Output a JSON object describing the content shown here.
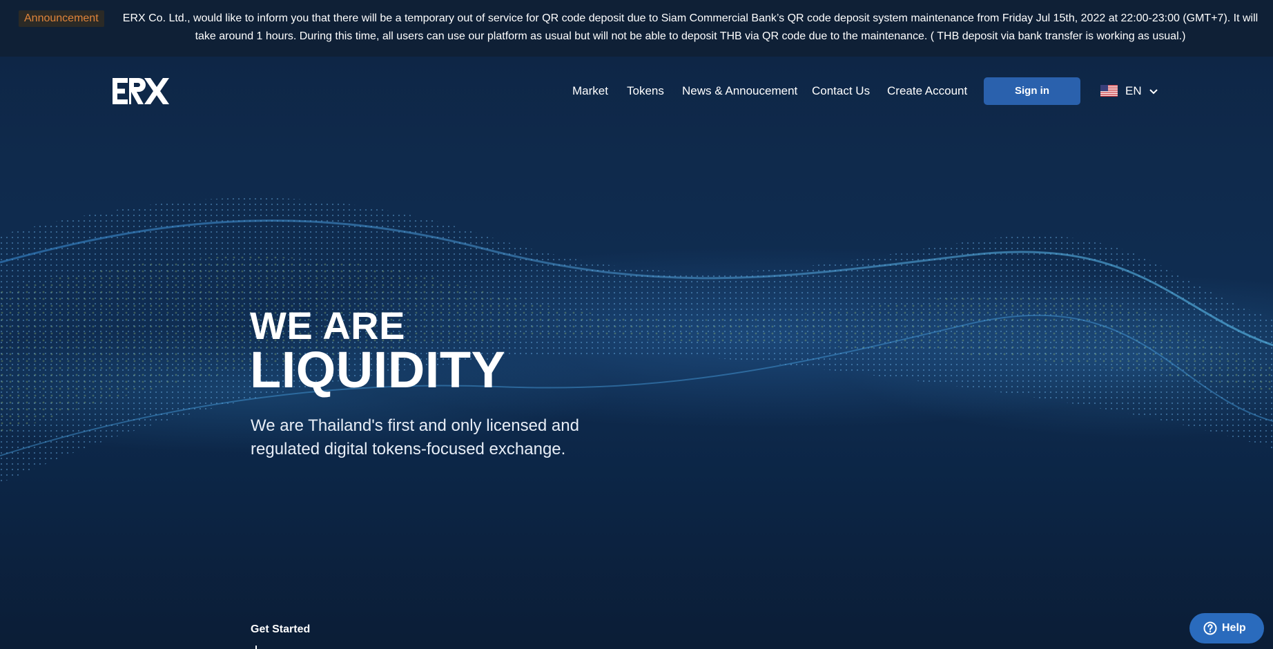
{
  "announcement": {
    "badge": "Announcement",
    "text": "ERX Co. Ltd., would like to inform you that there will be a temporary out of service for QR code deposit due to Siam Commercial Bank’s QR code deposit system maintenance from Friday Jul 15th, 2022 at 22:00-23:00 (GMT+7). It will take around 1 hours. During this time, all users can use our platform as usual but will not be able to deposit THB via QR code due to the maintenance. ( THB deposit via bank transfer is working as usual.)"
  },
  "header": {
    "logo_text": "ERX",
    "nav": [
      {
        "label": "Market"
      },
      {
        "label": "Tokens"
      },
      {
        "label": "News & Annoucement"
      },
      {
        "label": "Contact Us"
      },
      {
        "label": "Create Account"
      }
    ],
    "signin_label": "Sign in",
    "language": {
      "label": "EN",
      "flag_icon": "us-flag-icon"
    }
  },
  "hero": {
    "line1": "WE ARE",
    "line2": "LIQUIDITY",
    "subtitle": "We are Thailand's first and only licensed and regulated digital tokens-focused exchange.",
    "cta": "Get Started"
  },
  "help_widget": {
    "label": "Help",
    "icon": "question-circle-icon"
  },
  "colors": {
    "background": "#0f2a4c",
    "announcement_bar": "#0f2036",
    "announcement_badge_text": "#e0843a",
    "primary_button": "#2a61ad",
    "help_button": "#2a6bbd"
  }
}
